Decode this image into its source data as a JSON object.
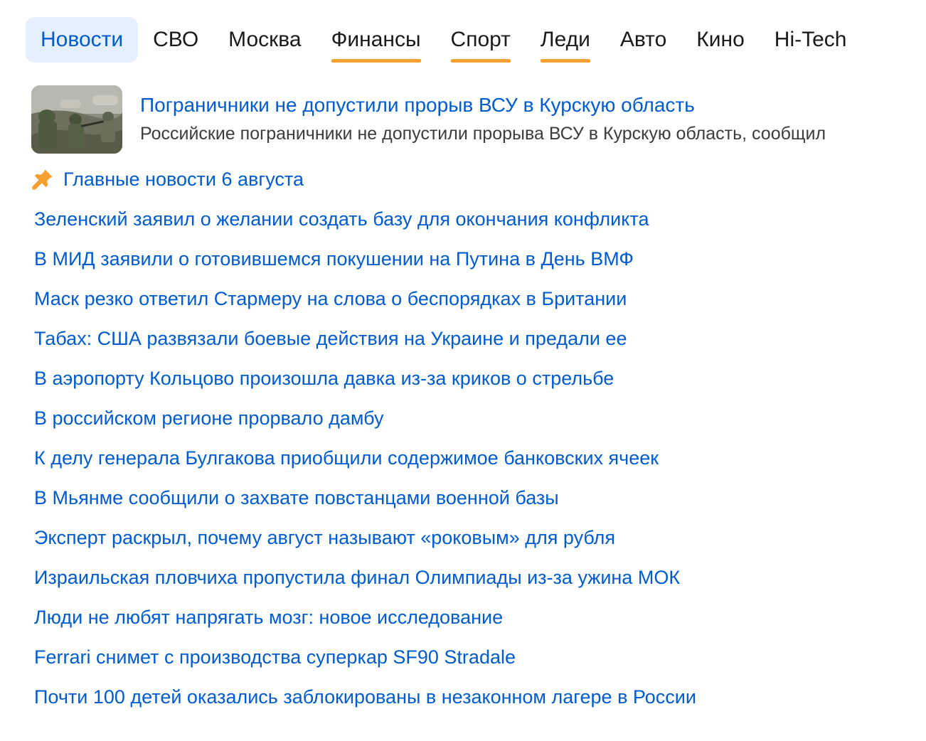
{
  "nav": {
    "tabs": [
      {
        "label": "Новости",
        "active": true,
        "accent": ""
      },
      {
        "label": "СВО",
        "active": false,
        "accent": ""
      },
      {
        "label": "Москва",
        "active": false,
        "accent": ""
      },
      {
        "label": "Финансы",
        "active": false,
        "accent": "#f5a031"
      },
      {
        "label": "Спорт",
        "active": false,
        "accent": "#f5a031"
      },
      {
        "label": "Леди",
        "active": false,
        "accent": "#f5a031"
      },
      {
        "label": "Авто",
        "active": false,
        "accent": ""
      },
      {
        "label": "Кино",
        "active": false,
        "accent": ""
      },
      {
        "label": "Hi-Tech",
        "active": false,
        "accent": ""
      }
    ]
  },
  "featured": {
    "title": "Пограничники не допустили прорыв ВСУ в Курскую область",
    "snippet": "Российские пограничники не допустили прорыва ВСУ в Курскую область, сообщил"
  },
  "headline": {
    "icon": "pin-icon",
    "title": "Главные новости 6 августа"
  },
  "news": [
    "Зеленский заявил о желании создать базу для окончания конфликта",
    "В МИД заявили о готовившемся покушении на Путина в День ВМФ",
    "Маск резко ответил Стармеру на слова о беспорядках в Британии",
    "Табах: США развязали боевые действия на Украине и предали ее",
    "В аэропорту Кольцово произошла давка из-за криков о стрельбе",
    "В российском регионе прорвало дамбу",
    "К делу генерала Булгакова приобщили содержимое банковских ячеек",
    "В Мьянме сообщили о захвате повстанцами военной базы",
    "Эксперт раскрыл, почему август называют «роковым» для рубля",
    "Израильская пловчиха пропустила финал Олимпиады из-за ужина МОК",
    "Люди не любят напрягать мозг: новое исследование",
    "Ferrari снимет с производства суперкар SF90 Stradale",
    "Почти 100 детей оказались заблокированы в незаконном лагере в России"
  ],
  "colors": {
    "link": "#005bd1",
    "active_tab_bg": "#e6effd",
    "accent_orange": "#f5a031"
  }
}
